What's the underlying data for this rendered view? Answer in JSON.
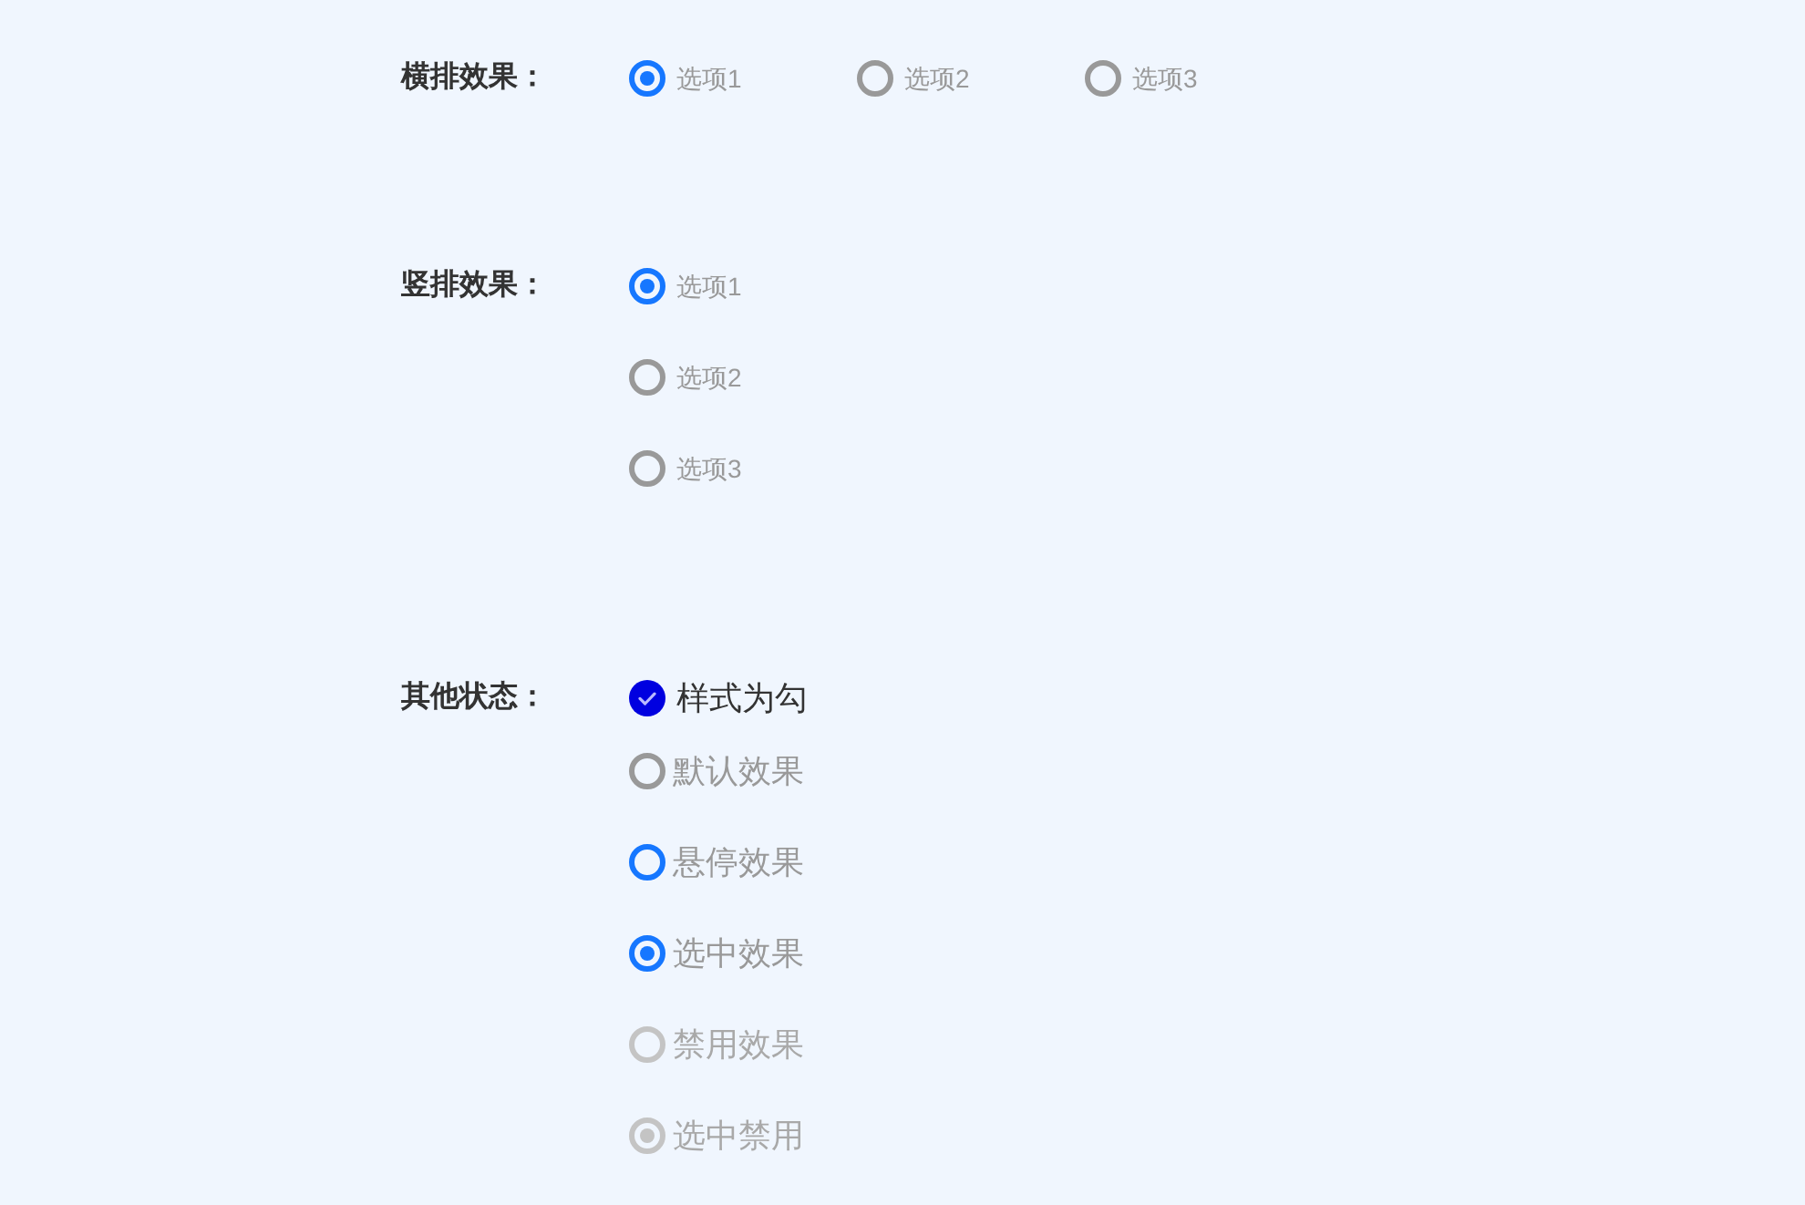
{
  "groups": [
    {
      "label": "横排效果：",
      "kind": "horizontal",
      "options": [
        {
          "label": "选项1",
          "selected": true
        },
        {
          "label": "选项2",
          "selected": false
        },
        {
          "label": "选项3",
          "selected": false
        }
      ]
    },
    {
      "label": "竖排效果：",
      "kind": "vertical",
      "options": [
        {
          "label": "选项1",
          "selected": true
        },
        {
          "label": "选项2",
          "selected": false
        },
        {
          "label": "选项3",
          "selected": false
        }
      ]
    },
    {
      "label": "其他状态：",
      "kind": "states",
      "options": [
        {
          "label": "样式为勾",
          "kind": "check",
          "selected": true,
          "hovered": false,
          "disabled": false
        },
        {
          "label": "默认效果",
          "kind": "radio",
          "selected": false,
          "hovered": false,
          "disabled": false
        },
        {
          "label": "悬停效果",
          "kind": "radio",
          "selected": false,
          "hovered": true,
          "disabled": false
        },
        {
          "label": "选中效果",
          "kind": "radio",
          "selected": true,
          "hovered": false,
          "disabled": false
        },
        {
          "label": "禁用效果",
          "kind": "radio",
          "selected": false,
          "hovered": false,
          "disabled": true
        },
        {
          "label": "选中禁用",
          "kind": "radio",
          "selected": true,
          "hovered": false,
          "disabled": true
        }
      ]
    }
  ]
}
